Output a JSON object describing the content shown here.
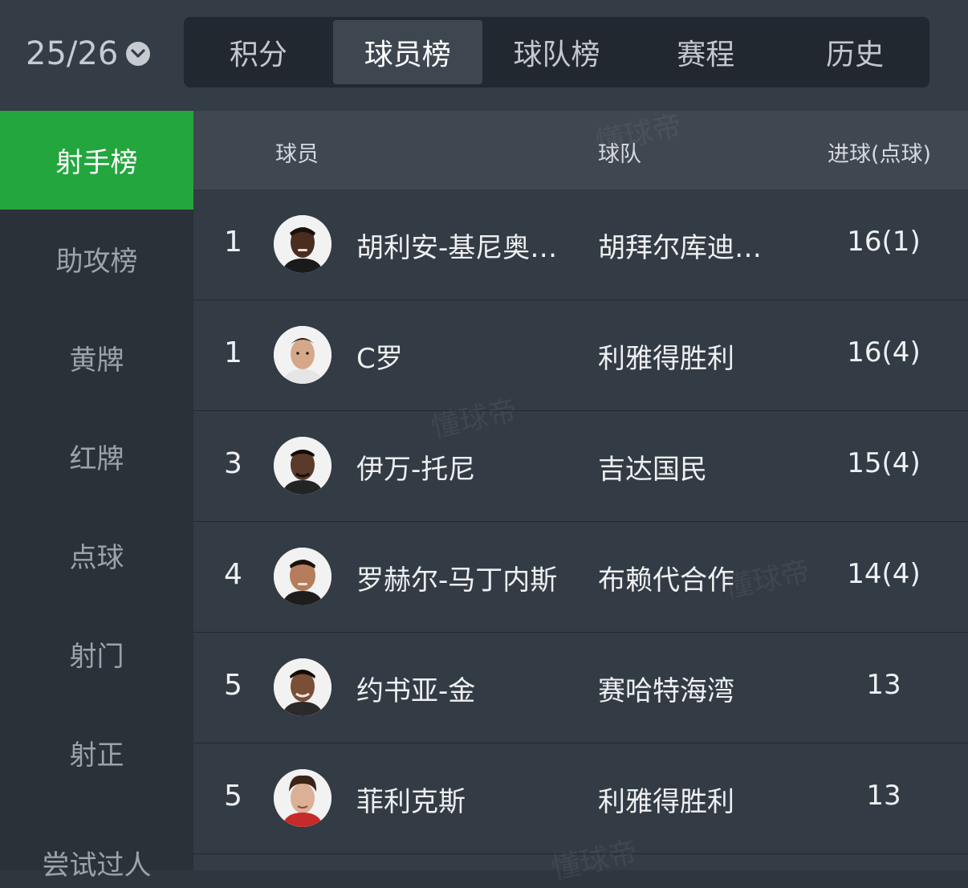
{
  "season": {
    "label": "25/26"
  },
  "tabs": [
    {
      "label": "积分"
    },
    {
      "label": "球员榜"
    },
    {
      "label": "球队榜"
    },
    {
      "label": "赛程"
    },
    {
      "label": "历史"
    }
  ],
  "sidebar": {
    "items": [
      {
        "label": "射手榜"
      },
      {
        "label": "助攻榜"
      },
      {
        "label": "黄牌"
      },
      {
        "label": "红牌"
      },
      {
        "label": "点球"
      },
      {
        "label": "射门"
      },
      {
        "label": "射正"
      },
      {
        "label": "尝试过人"
      }
    ]
  },
  "table": {
    "headers": {
      "player": "球员",
      "team": "球队",
      "goals": "进球(点球)"
    },
    "rows": [
      {
        "rank": "1",
        "name": "胡利安-基尼奥…",
        "team": "胡拜尔库迪…",
        "goals": "16(1)"
      },
      {
        "rank": "1",
        "name": "C罗",
        "team": "利雅得胜利",
        "goals": "16(4)"
      },
      {
        "rank": "3",
        "name": "伊万-托尼",
        "team": "吉达国民",
        "goals": "15(4)"
      },
      {
        "rank": "4",
        "name": "罗赫尔-马丁内斯",
        "team": "布赖代合作",
        "goals": "14(4)"
      },
      {
        "rank": "5",
        "name": "约书亚-金",
        "team": "赛哈特海湾",
        "goals": "13"
      },
      {
        "rank": "5",
        "name": "菲利克斯",
        "team": "利雅得胜利",
        "goals": "13"
      }
    ]
  },
  "watermark": "懂球帝"
}
